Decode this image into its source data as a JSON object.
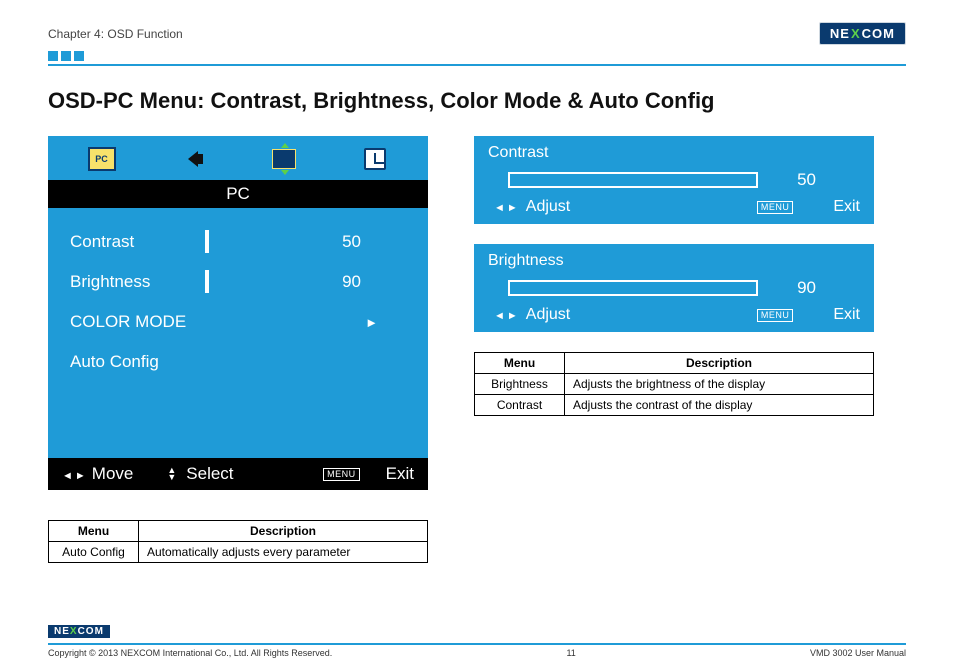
{
  "header": {
    "chapter": "Chapter 4: OSD Function",
    "brand_pre": "NE",
    "brand_x": "X",
    "brand_post": "COM"
  },
  "title": "OSD-PC Menu: Contrast, Brightness, Color Mode & Auto Config",
  "osd": {
    "tab": "PC",
    "rows": {
      "contrast_label": "Contrast",
      "contrast_value": "50",
      "contrast_pct": 50,
      "brightness_label": "Brightness",
      "brightness_value": "90",
      "brightness_pct": 90,
      "colormode_label": "COLOR MODE",
      "autoconfig_label": "Auto Config"
    },
    "footer": {
      "move": "Move",
      "select": "Select",
      "menu_chip": "MENU",
      "exit": "Exit"
    }
  },
  "mini": {
    "contrast": {
      "title": "Contrast",
      "value": "50",
      "pct": 50,
      "adjust": "Adjust",
      "menu_chip": "MENU",
      "exit": "Exit"
    },
    "brightness": {
      "title": "Brightness",
      "value": "90",
      "pct": 90,
      "adjust": "Adjust",
      "menu_chip": "MENU",
      "exit": "Exit"
    }
  },
  "table_right": {
    "head_menu": "Menu",
    "head_desc": "Description",
    "rows": [
      {
        "menu": "Brightness",
        "desc": "Adjusts the brightness of the display"
      },
      {
        "menu": "Contrast",
        "desc": "Adjusts the contrast of the display"
      }
    ]
  },
  "table_left": {
    "head_menu": "Menu",
    "head_desc": "Description",
    "rows": [
      {
        "menu": "Auto Config",
        "desc": "Automatically adjusts every parameter"
      }
    ]
  },
  "footer": {
    "copyright": "Copyright © 2013 NEXCOM International Co., Ltd. All Rights Reserved.",
    "page": "11",
    "doc": "VMD 3002 User Manual"
  }
}
